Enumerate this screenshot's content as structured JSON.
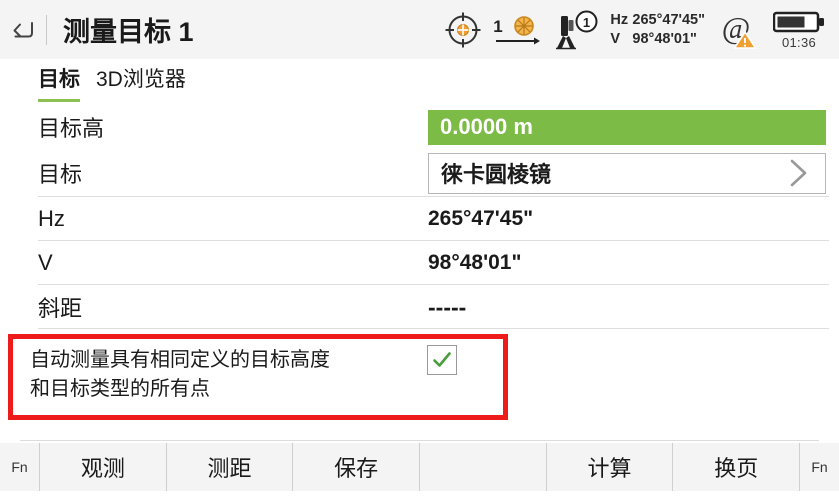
{
  "window": {
    "title": "测量目标 1",
    "back_icon": "back-arrow-icon"
  },
  "statusbar": {
    "crosshair_icon": "crosshair-target-icon",
    "prism_icon": "prism-offset-icon",
    "prism_number": "1",
    "station_icon": "total-station-icon",
    "station_face": "1",
    "hz_label": "Hz",
    "hz_value": "265°47'45\"",
    "v_label": "V",
    "v_value": "98°48'01\"",
    "at_icon": "at-sign-warning-icon",
    "battery_icon": "battery-icon",
    "battery_time": "01:36"
  },
  "tabs": [
    {
      "label": "目标",
      "active": true
    },
    {
      "label": "3D浏览器",
      "active": false
    }
  ],
  "form": {
    "rows": [
      {
        "label": "目标高",
        "value": "0.0000 m",
        "style": "green-input"
      },
      {
        "label": "目标",
        "value": "徕卡圆棱镜",
        "style": "select-box"
      },
      {
        "label": "Hz",
        "value": "265°47'45\"",
        "style": "readonly"
      },
      {
        "label": "V",
        "value": "98°48'01\"",
        "style": "readonly"
      },
      {
        "label": "斜距",
        "value": "-----",
        "style": "readonly"
      }
    ]
  },
  "auto_measure": {
    "text_line1": "自动测量具有相同定义的目标高度",
    "text_line2": "和目标类型的所有点",
    "checked": true,
    "check_glyph": "✓"
  },
  "footer": {
    "keys": [
      {
        "label": "Fn",
        "type": "fn"
      },
      {
        "label": "观测",
        "type": "key"
      },
      {
        "label": "测距",
        "type": "key"
      },
      {
        "label": "保存",
        "type": "key"
      },
      {
        "label": "",
        "type": "spacer"
      },
      {
        "label": "计算",
        "type": "key"
      },
      {
        "label": "换页",
        "type": "key"
      },
      {
        "label": "Fn",
        "type": "fn-last"
      }
    ]
  },
  "colors": {
    "accent_green": "#7cbb45",
    "tab_underline": "#8cc152",
    "highlight_red": "#ee1b1b",
    "status_orange": "#f0a030",
    "chrome_gray": "#f4f4f4"
  }
}
